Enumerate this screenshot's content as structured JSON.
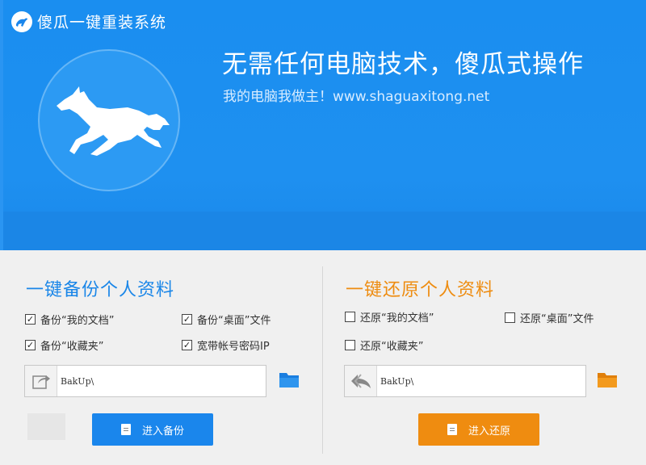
{
  "app": {
    "title": "傻瓜一键重装系统"
  },
  "banner": {
    "slogan": "无需任何电脑技术，傻瓜式操作",
    "subline": "我的电脑我做主！www.shaguaxitong.net"
  },
  "backup": {
    "title": "一键备份个人资料",
    "options": [
      {
        "label": "备份“我的文档”",
        "checked": true
      },
      {
        "label": "备份“桌面”文件",
        "checked": true
      },
      {
        "label": "备份“收藏夹”",
        "checked": true
      },
      {
        "label": "宽带帐号密码IP",
        "checked": true
      }
    ],
    "path": "BakUp\\",
    "button": "进入备份"
  },
  "restore": {
    "title": "一键还原个人资料",
    "options": [
      {
        "label": "还原“我的文档”",
        "checked": false
      },
      {
        "label": "还原“桌面”文件",
        "checked": false
      },
      {
        "label": "还原“收藏夹”",
        "checked": false
      }
    ],
    "path": "BakUp\\",
    "button": "进入还原"
  },
  "colors": {
    "brand_blue": "#1a86ec",
    "accent_orange": "#ef8c10"
  }
}
